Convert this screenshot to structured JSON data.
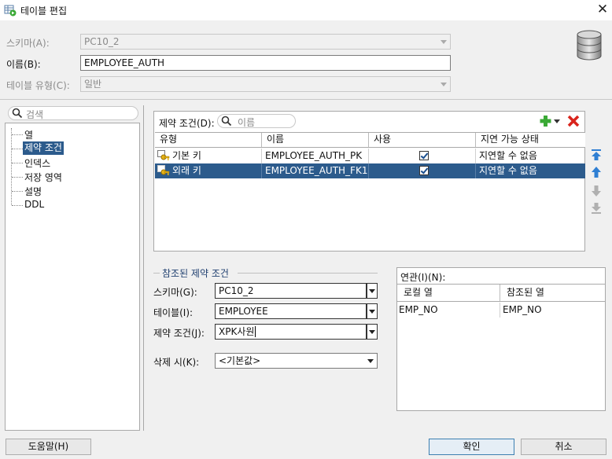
{
  "window": {
    "title": "테이블 편집",
    "close_icon": "close-icon"
  },
  "form": {
    "schema_label": "스키마(A):",
    "schema_value": "PC10_2",
    "name_label": "이름(B):",
    "name_value": "EMPLOYEE_AUTH",
    "table_type_label": "테이블 유형(C):",
    "table_type_value": "일반"
  },
  "nav": {
    "search_placeholder": "검색",
    "items": [
      {
        "label": "열",
        "selected": false
      },
      {
        "label": "제약 조건",
        "selected": true
      },
      {
        "label": "인덱스",
        "selected": false
      },
      {
        "label": "저장 영역",
        "selected": false
      },
      {
        "label": "설명",
        "selected": false
      },
      {
        "label": "DDL",
        "selected": false
      }
    ]
  },
  "constraints": {
    "label": "제약 조건(D):",
    "filter_placeholder": "이름",
    "columns": [
      "유형",
      "이름",
      "사용",
      "지연 가능 상태"
    ],
    "rows": [
      {
        "type": "기본 키",
        "name": "EMPLOYEE_AUTH_PK",
        "enabled": true,
        "deferrable": "지연할 수 없음",
        "selected": false
      },
      {
        "type": "외래 키",
        "name": "EMPLOYEE_AUTH_FK1",
        "enabled": true,
        "deferrable": "지연할 수 없음",
        "selected": true
      }
    ]
  },
  "referenced": {
    "section_title": "참조된 제약 조건",
    "schema_label": "스키마(G):",
    "schema_value": "PC10_2",
    "table_label": "테이블(I):",
    "table_value": "EMPLOYEE",
    "constraint_label": "제약 조건(J):",
    "constraint_value": "XPK사원",
    "on_delete_label": "삭제 시(K):",
    "on_delete_value": "<기본값>"
  },
  "association": {
    "label": "연관(I)(N):",
    "columns": [
      "로컬 열",
      "참조된 열"
    ],
    "rows": [
      {
        "local": "EMP_NO",
        "referenced": "EMP_NO"
      }
    ]
  },
  "buttons": {
    "help": "도움말(H)",
    "ok": "확인",
    "cancel": "취소"
  },
  "colors": {
    "selection": "#2c5b8c",
    "add": "#3aa935",
    "delete": "#d9241c",
    "arrow_blue": "#2f7fd3"
  }
}
